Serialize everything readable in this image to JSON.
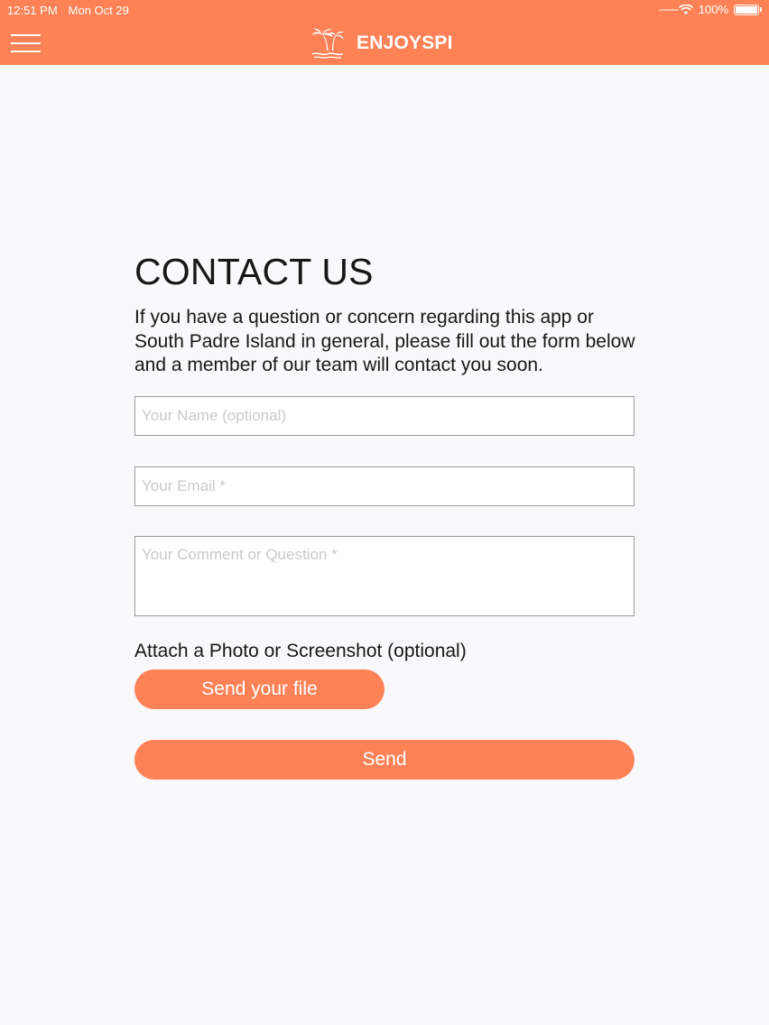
{
  "status_bar": {
    "time": "12:51 PM",
    "date": "Mon Oct 29",
    "battery": "100%"
  },
  "header": {
    "brand": "ENJOYSPI",
    "background_color": "#ff8257"
  },
  "page": {
    "title": "CONTACT US",
    "description": "If you have  a question or concern regarding this app or South Padre Island in general, please fill out the form below and a member of our team will contact you soon."
  },
  "form": {
    "name_placeholder": "Your Name (optional)",
    "email_placeholder": "Your Email *",
    "comment_placeholder": "Your Comment or Question *",
    "attach_label": "Attach a Photo or Screenshot (optional)",
    "file_button_label": "Send your file",
    "send_button_label": "Send"
  },
  "icons": {
    "menu": "hamburger-menu-icon",
    "logo": "palm-tree-logo-icon",
    "wifi": "wifi-icon",
    "battery": "battery-icon"
  }
}
